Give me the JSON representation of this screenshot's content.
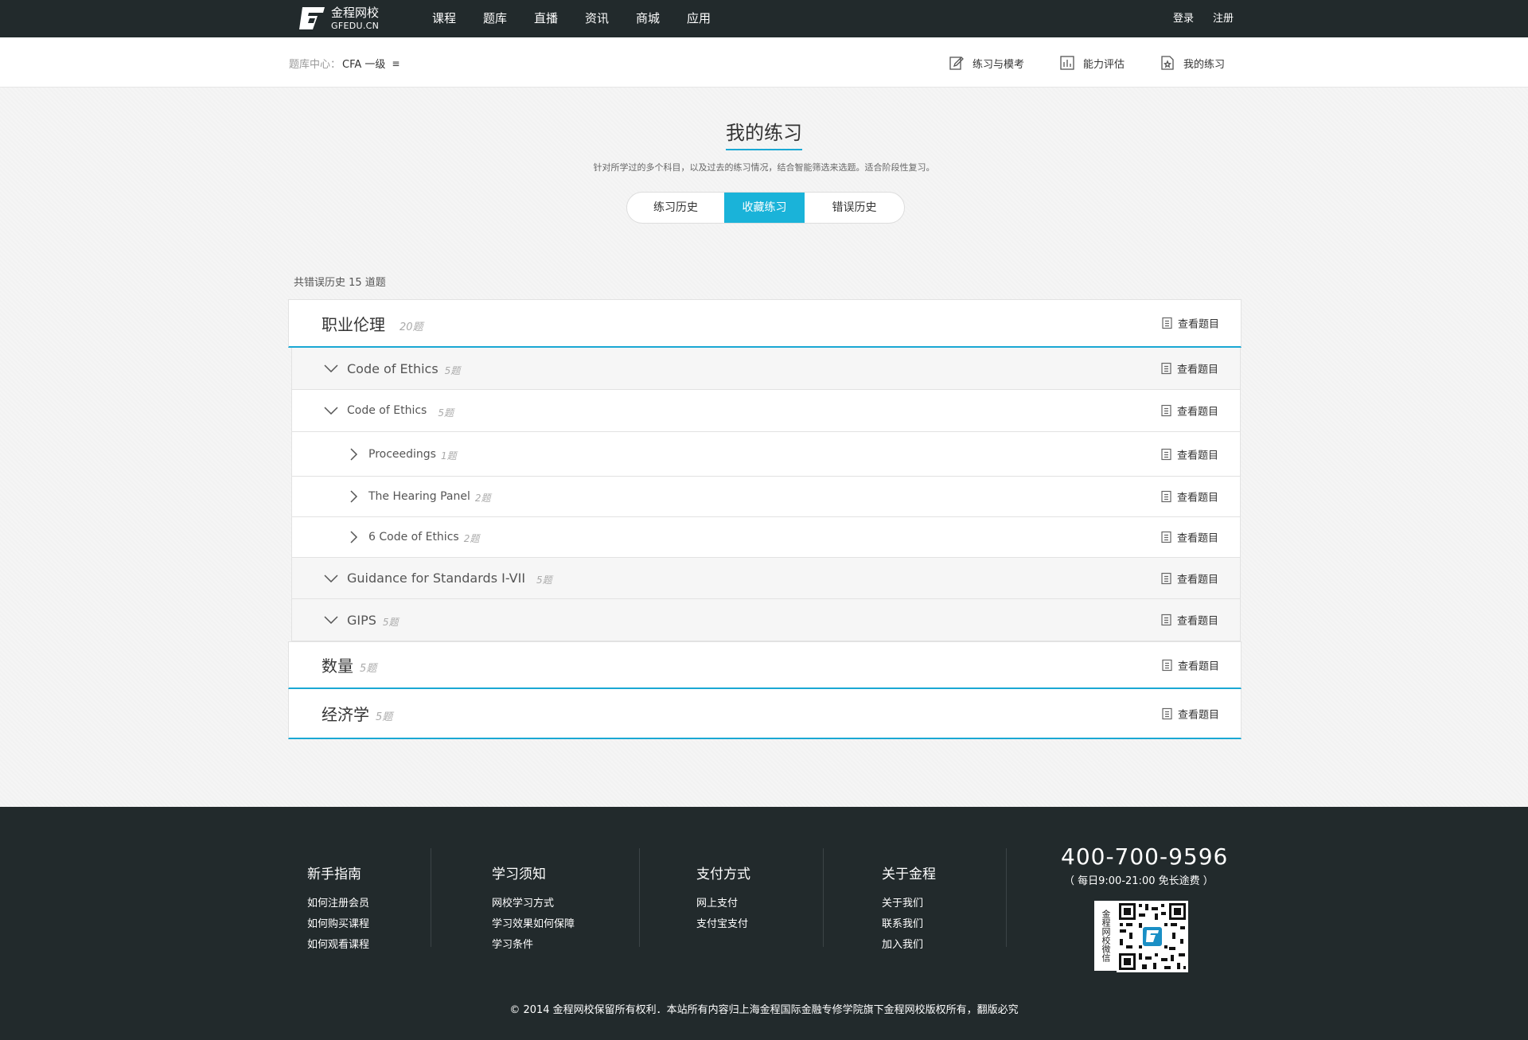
{
  "brand": {
    "name_cn": "金程网校",
    "name_en": "GFEDU.CN"
  },
  "nav": {
    "items": [
      "课程",
      "题库",
      "直播",
      "资讯",
      "商城",
      "应用"
    ]
  },
  "auth": {
    "login": "登录",
    "register": "注册"
  },
  "breadcrumb": {
    "parent": "题库中心：",
    "current": "CFA 一级",
    "menu_icon": "≡"
  },
  "subnav": {
    "practice": "练习与模考",
    "assessment": "能力评估",
    "mine": "我的练习"
  },
  "page": {
    "title": "我的练习",
    "description": "针对所学过的多个科目，以及过去的练习情况，结合智能筛选来选题。适合阶段性复习。"
  },
  "tabs": [
    {
      "label": "练习历史",
      "active": false
    },
    {
      "label": "收藏练习",
      "active": true
    },
    {
      "label": "错误历史",
      "active": false
    }
  ],
  "summary": "共错误历史 15 道题",
  "view_label": "查看题目",
  "list": {
    "ethics": {
      "name": "职业伦理",
      "count": "20题"
    },
    "coe_1": {
      "name": "Code of Ethics",
      "count": "5题"
    },
    "coe_2": {
      "name": "Code of Ethics",
      "count": "5题"
    },
    "proceedings": {
      "name": "Proceedings",
      "count": "1题"
    },
    "hearing": {
      "name": "The Hearing Panel",
      "count": "2题"
    },
    "six_coe": {
      "name": "6 Code of Ethics",
      "count": "2题"
    },
    "guidance": {
      "name": "Guidance for Standards I-VII",
      "count": "5题"
    },
    "gips": {
      "name": "GIPS",
      "count": "5题"
    },
    "quant": {
      "name": "数量",
      "count": "5题"
    },
    "econ": {
      "name": "经济学",
      "count": "5题"
    }
  },
  "footer": {
    "guide": {
      "title": "新手指南",
      "links": [
        "如何注册会员",
        "如何购买课程",
        "如何观看课程"
      ]
    },
    "study": {
      "title": "学习须知",
      "links": [
        "网校学习方式",
        "学习效果如何保障",
        "学习条件"
      ]
    },
    "pay": {
      "title": "支付方式",
      "links": [
        "网上支付",
        "支付宝支付"
      ]
    },
    "about": {
      "title": "关于金程",
      "links": [
        "关于我们",
        "联系我们",
        "加入我们"
      ]
    },
    "phone": "400-700-9596",
    "hours": "（ 每日9:00-21:00    免长途费 ）",
    "qr_label": "金程网校微信",
    "copyright": "© 2014 金程网校保留所有权利．本站所有内容归上海金程国际金融专修学院旗下金程网校版权所有，翻版必究"
  },
  "colors": {
    "accent": "#1ab3d9",
    "dark": "#222a2c"
  }
}
